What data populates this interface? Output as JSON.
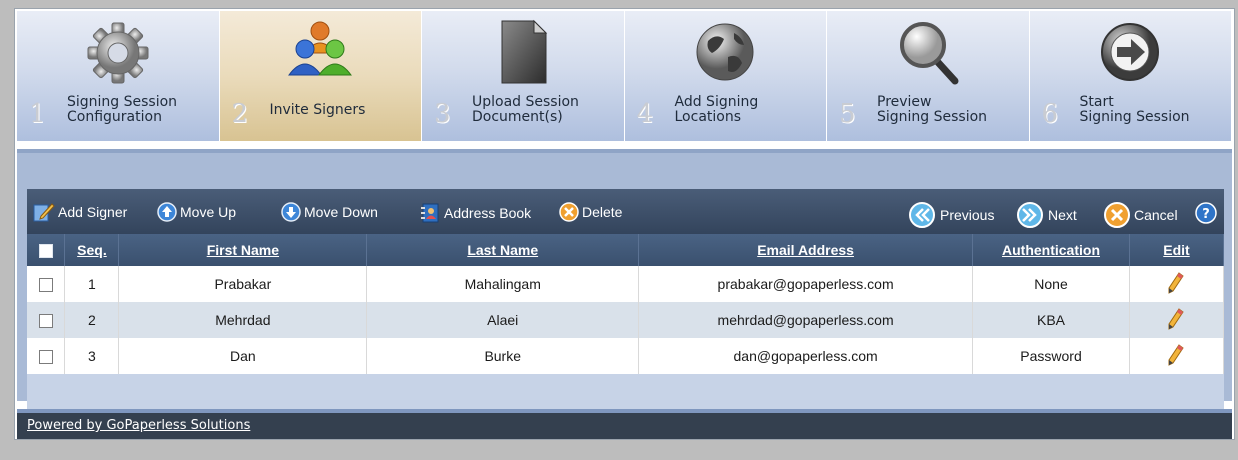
{
  "steps": [
    {
      "num": "1",
      "label": "Signing Session\nConfiguration",
      "icon": "gear-icon",
      "active": false
    },
    {
      "num": "2",
      "label": "Invite Signers",
      "icon": "users-icon",
      "active": true
    },
    {
      "num": "3",
      "label": "Upload Session\nDocument(s)",
      "icon": "document-icon",
      "active": false
    },
    {
      "num": "4",
      "label": "Add Signing\nLocations",
      "icon": "globe-icon",
      "active": false
    },
    {
      "num": "5",
      "label": "Preview\nSigning Session",
      "icon": "magnifier-icon",
      "active": false
    },
    {
      "num": "6",
      "label": "Start\nSigning Session",
      "icon": "arrow-right-icon",
      "active": false
    }
  ],
  "toolbar": {
    "add_signer": "Add Signer",
    "move_up": "Move Up",
    "move_down": "Move Down",
    "address_book": "Address Book",
    "delete": "Delete",
    "previous": "Previous",
    "next": "Next",
    "cancel": "Cancel"
  },
  "table": {
    "headers": {
      "seq": "Seq.",
      "first": "First Name",
      "last": "Last Name",
      "email": "Email Address",
      "auth": "Authentication",
      "edit": "Edit"
    },
    "rows": [
      {
        "seq": "1",
        "first": "Prabakar",
        "last": "Mahalingam",
        "email": "prabakar@gopaperless.com",
        "auth": "None"
      },
      {
        "seq": "2",
        "first": "Mehrdad",
        "last": "Alaei",
        "email": "mehrdad@gopaperless.com",
        "auth": "KBA"
      },
      {
        "seq": "3",
        "first": "Dan",
        "last": "Burke",
        "email": "dan@gopaperless.com",
        "auth": "Password"
      }
    ]
  },
  "footer": {
    "link": "Powered by GoPaperless Solutions"
  },
  "colors": {
    "toolbar": "#33445c",
    "header": "#3a506e",
    "active_step": "#eadbbb",
    "step": "#d2dbec",
    "footer": "#34404f"
  }
}
